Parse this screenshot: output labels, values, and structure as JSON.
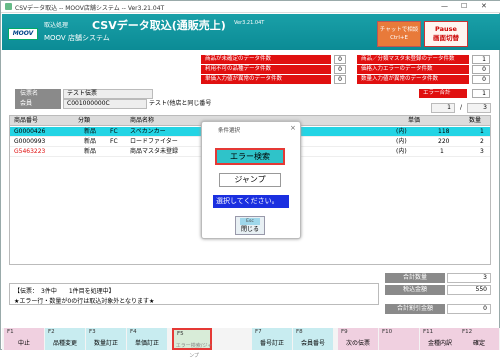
{
  "window": {
    "title": "CSVデータ取込 -- MOOV店舗システム -- Ver3.21.04T",
    "minimize": "—",
    "maximize": "☐",
    "close": "✕"
  },
  "header": {
    "logo": "MOOV",
    "subtitle": "取込処理",
    "title": "CSVデータ取込(通販売上)",
    "system": "MOOV 店舗システム",
    "version": "Ver3.21.04T",
    "chat_label": "チャットで相談",
    "chat_key": "Ctrl+E",
    "pause_label": "Pause",
    "pause_sub": "画面切替"
  },
  "errors": {
    "left": [
      {
        "label": "商品が未確定のデータ件数",
        "value": "0"
      },
      {
        "label": "利用不可の品種データ件数",
        "value": "0"
      },
      {
        "label": "単価入力値が異常のデータ件数",
        "value": "0"
      }
    ],
    "right": [
      {
        "label": "商品／分類マスタ未登録のデータ件数",
        "value": "1"
      },
      {
        "label": "価格入力エラーのデータ件数",
        "value": "0"
      },
      {
        "label": "数量入力値が異常のデータ件数",
        "value": "0"
      }
    ],
    "total_label": "エラー合計",
    "total_value": "1"
  },
  "info": {
    "slip_label": "伝票名",
    "slip_value": "テスト伝票",
    "member_label": "会員",
    "member_code": "C001000000C",
    "member_name": "テスト(他店と同じ番号"
  },
  "pagination": {
    "current": "1",
    "separator": "/",
    "total": "3"
  },
  "table": {
    "headers": [
      "商品番号",
      "分類",
      "商品名称",
      "単価",
      "数量"
    ],
    "rows": [
      {
        "code": "G0000426",
        "kind": "新品",
        "cls": "FC",
        "name": "スペカンカー",
        "unit": "(内)",
        "price": "118",
        "qty": "1",
        "selected": true,
        "error": false
      },
      {
        "code": "G0000993",
        "kind": "新品",
        "cls": "FC",
        "name": "ロードファイター",
        "unit": "(内)",
        "price": "220",
        "qty": "2",
        "selected": false,
        "error": false
      },
      {
        "code": "G5463223",
        "kind": "新品",
        "cls": "",
        "name": "商品マスタ未登録",
        "unit": "(内)",
        "price": "1",
        "qty": "3",
        "selected": false,
        "error": true
      }
    ]
  },
  "status": {
    "line1": "【伝票：　3件中　　1件目を処理中】",
    "line2": "★エラー行・数量が0の行は取込対象外となります★"
  },
  "summary": {
    "qty_label": "合計数量",
    "qty_value": "3",
    "amount_label": "税込金額",
    "amount_value": "550",
    "disc_label": "合計割引金額",
    "disc_value": "0"
  },
  "fkeys": [
    {
      "num": "F1",
      "label": "中止"
    },
    {
      "num": "F2",
      "label": "品種変更"
    },
    {
      "num": "F3",
      "label": "数量訂正"
    },
    {
      "num": "F4",
      "label": "単価訂正"
    },
    {
      "num": "F5",
      "label": "エラー検索/ジャンプ"
    },
    {
      "num": "F7",
      "label": "番号訂正"
    },
    {
      "num": "F8",
      "label": "会員番号"
    },
    {
      "num": "F9",
      "label": "次の伝票"
    },
    {
      "num": "F10",
      "label": ""
    },
    {
      "num": "F11",
      "label": "金種内訳"
    },
    {
      "num": "F12",
      "label": "確定"
    }
  ],
  "dialog": {
    "title": "条件選択",
    "close": "×",
    "error_search": "エラー検索",
    "jump": "ジャンプ",
    "message": "選択してください。",
    "close_key": "Esc",
    "close_label": "閉じる"
  },
  "colors": {
    "header": "#1aa0a8",
    "error": "#e01010",
    "selected_row": "#23d4e4",
    "dialog_msg": "#1a2fe0",
    "highlight": "#e53935"
  }
}
